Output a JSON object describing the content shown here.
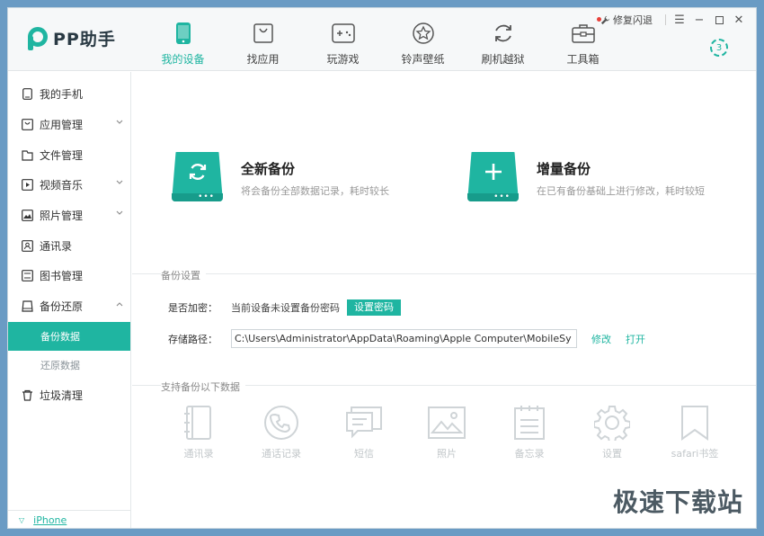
{
  "app": {
    "logo_text": "PP助手",
    "repair_label": "修复闪退",
    "download_count": "3"
  },
  "colors": {
    "accent": "#1fb5a1",
    "text": "#333333",
    "muted": "#999999"
  },
  "nav": [
    {
      "label": "我的设备",
      "icon": "phone-icon",
      "active": true
    },
    {
      "label": "找应用",
      "icon": "app-bag-icon"
    },
    {
      "label": "玩游戏",
      "icon": "gamepad-icon"
    },
    {
      "label": "铃声壁纸",
      "icon": "star-icon"
    },
    {
      "label": "刷机越狱",
      "icon": "refresh-icon"
    },
    {
      "label": "工具箱",
      "icon": "toolbox-icon"
    }
  ],
  "sidebar": {
    "items": [
      {
        "label": "我的手机",
        "icon": "phone-icon"
      },
      {
        "label": "应用管理",
        "icon": "app-bag-icon",
        "expandable": true
      },
      {
        "label": "文件管理",
        "icon": "folder-icon"
      },
      {
        "label": "视频音乐",
        "icon": "video-icon",
        "expandable": true
      },
      {
        "label": "照片管理",
        "icon": "photo-icon",
        "expandable": true
      },
      {
        "label": "通讯录",
        "icon": "contacts-icon"
      },
      {
        "label": "图书管理",
        "icon": "book-icon"
      },
      {
        "label": "备份还原",
        "icon": "backup-icon",
        "expanded": true
      }
    ],
    "sub_items": [
      {
        "label": "备份数据",
        "active": true
      },
      {
        "label": "还原数据"
      }
    ],
    "last_item": {
      "label": "垃圾清理",
      "icon": "trash-icon"
    },
    "device": "iPhone"
  },
  "backup": {
    "full": {
      "title": "全新备份",
      "desc": "将会备份全部数据记录，耗时较长"
    },
    "incremental": {
      "title": "增量备份",
      "desc": "在已有备份基础上进行修改，耗时较短"
    }
  },
  "settings": {
    "header": "备份设置",
    "encrypt_label": "是否加密：",
    "encrypt_value": "当前设备未设置备份密码",
    "set_password_btn": "设置密码",
    "path_label": "存储路径：",
    "path_value": "C:\\Users\\Administrator\\AppData\\Roaming\\Apple Computer\\MobileSy",
    "modify_link": "修改",
    "open_link": "打开"
  },
  "supported": {
    "header": "支持备份以下数据",
    "types": [
      {
        "label": "通讯录",
        "icon": "contacts-book-icon"
      },
      {
        "label": "通话记录",
        "icon": "phone-call-icon"
      },
      {
        "label": "短信",
        "icon": "sms-icon"
      },
      {
        "label": "照片",
        "icon": "photo-icon"
      },
      {
        "label": "备忘录",
        "icon": "memo-icon"
      },
      {
        "label": "设置",
        "icon": "settings-gear-icon"
      },
      {
        "label": "safari书签",
        "icon": "bookmark-icon"
      }
    ]
  },
  "watermark": "极速下载站"
}
